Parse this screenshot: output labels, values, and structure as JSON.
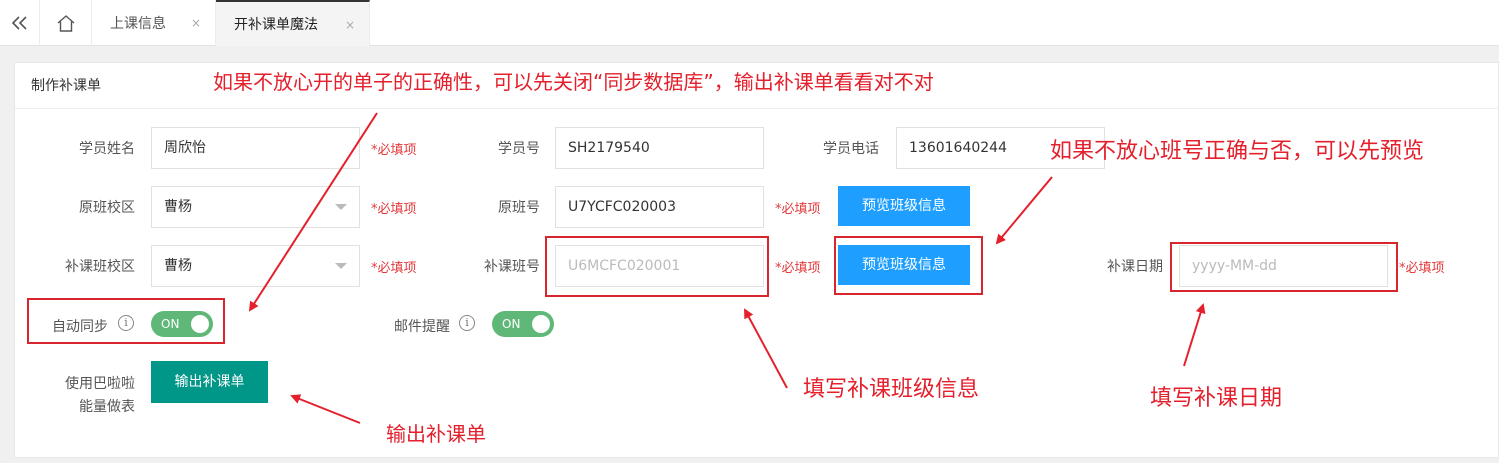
{
  "tabbar": {
    "tabs": [
      {
        "label": "上课信息",
        "close": "×"
      },
      {
        "label": "开补课单魔法",
        "close": "×"
      }
    ]
  },
  "panel": {
    "title": "制作补课单"
  },
  "form": {
    "student_name": {
      "label": "学员姓名",
      "value": "周欣怡",
      "required": "*必填项"
    },
    "student_id": {
      "label": "学员号",
      "value": "SH2179540"
    },
    "student_phone": {
      "label": "学员电话",
      "value": "13601640244"
    },
    "orig_campus": {
      "label": "原班校区",
      "value": "曹杨",
      "required": "*必填项"
    },
    "orig_class": {
      "label": "原班号",
      "value": "U7YCFC020003",
      "required": "*必填项"
    },
    "preview_btn_1": "预览班级信息",
    "makeup_campus": {
      "label": "补课班校区",
      "value": "曹杨",
      "required": "*必填项"
    },
    "makeup_class": {
      "label": "补课班号",
      "placeholder": "U6MCFC020001",
      "required": "*必填项"
    },
    "preview_btn_2": "预览班级信息",
    "makeup_date": {
      "label": "补课日期",
      "placeholder": "yyyy-MM-dd",
      "required": "*必填项"
    },
    "auto_sync": {
      "label": "自动同步",
      "state": "ON"
    },
    "mail_remind": {
      "label": "邮件提醒",
      "state": "ON"
    },
    "output_label_line1": "使用巴啦啦",
    "output_label_line2": "能量做表",
    "output_btn": "输出补课单"
  },
  "annotations": {
    "top": "如果不放心开的单子的正确性，可以先关闭“同步数据库”，输出补课单看看对不对",
    "right": "如果不放心班号正确与否，可以先预览",
    "class_info": "填写补课班级信息",
    "date": "填写补课日期",
    "output": "输出补课单"
  },
  "colors": {
    "annotation": "#e4202c",
    "primary": "#1e9fff",
    "success": "#009688",
    "switch_on": "#5fb878"
  }
}
